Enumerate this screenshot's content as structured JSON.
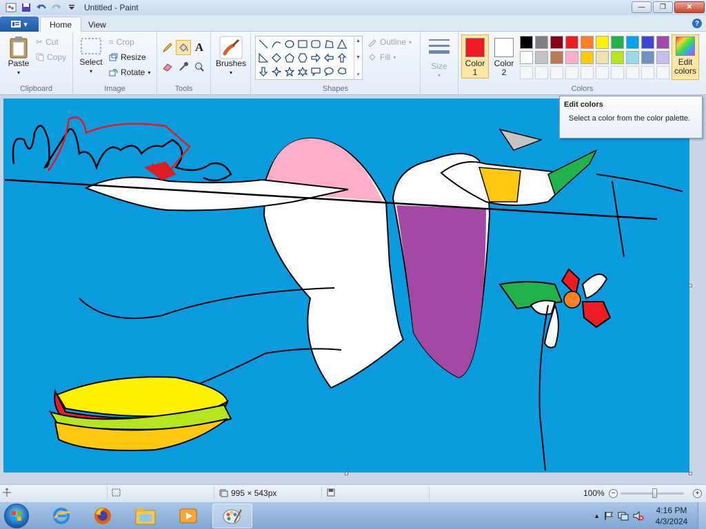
{
  "window": {
    "title": "Untitled - Paint",
    "minimize_label": "—",
    "restore_label": "❐",
    "close_label": "✕"
  },
  "tabs": {
    "home": "Home",
    "view": "View"
  },
  "clipboard": {
    "paste": "Paste",
    "cut": "Cut",
    "copy": "Copy",
    "label": "Clipboard"
  },
  "image": {
    "select": "Select",
    "crop": "Crop",
    "resize": "Resize",
    "rotate": "Rotate",
    "label": "Image"
  },
  "tools": {
    "label": "Tools",
    "active_tool": "fill-icon"
  },
  "brushes": {
    "label": "Brushes"
  },
  "shapes": {
    "outline": "Outline",
    "fill": "Fill",
    "label": "Shapes"
  },
  "size": {
    "label": "Size"
  },
  "colors": {
    "color1": "Color",
    "color1_num": "1",
    "color2": "Color",
    "color2_num": "2",
    "edit_line1": "Edit",
    "edit_line2": "colors",
    "label": "Colors",
    "color1_value": "#ed1c24",
    "color2_value": "#ffffff",
    "palette_row1": [
      "#000000",
      "#7f7f7f",
      "#880015",
      "#ed1c24",
      "#ff7f27",
      "#fff200",
      "#22b14c",
      "#00a2e8",
      "#3f48cc",
      "#a349a4"
    ],
    "palette_row2": [
      "#ffffff",
      "#c3c3c3",
      "#b97a57",
      "#ffaec9",
      "#ffc90e",
      "#efe4b0",
      "#b5e61d",
      "#99d9ea",
      "#7092be",
      "#c8bfe7"
    ]
  },
  "tooltip": {
    "title": "Edit colors",
    "text": "Select a color from the color palette."
  },
  "canvas": {
    "background": "#0a9bdf"
  },
  "statusbar": {
    "dimensions": "995 × 543px",
    "zoom": "100%",
    "zoom_level": 1.0
  },
  "taskbar": {
    "time": "4:16 PM",
    "date": "4/3/2024"
  }
}
